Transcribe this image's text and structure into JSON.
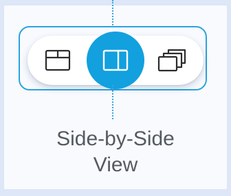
{
  "view_modes": {
    "items": [
      {
        "icon": "stacked-view-icon",
        "active": false
      },
      {
        "icon": "side-by-side-view-icon",
        "active": true
      },
      {
        "icon": "overlapping-windows-icon",
        "active": false
      }
    ],
    "selected_caption_line1": "Side-by-Side",
    "selected_caption_line2": "View"
  },
  "colors": {
    "accent": "#12a0df",
    "frame": "#2aa3df",
    "background": "#dde7f7",
    "panel": "#f8fafe",
    "caption_text": "#555a60",
    "icon_stroke": "#2b2b2b"
  }
}
